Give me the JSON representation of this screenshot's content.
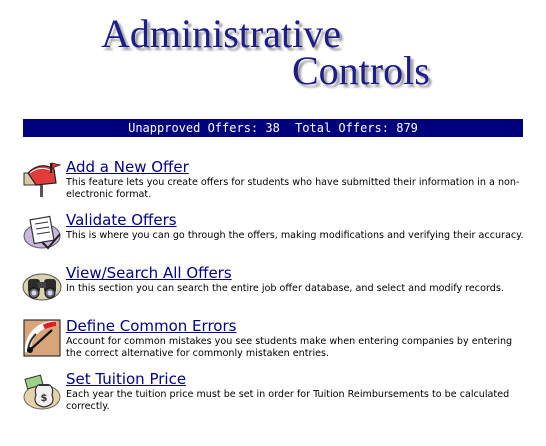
{
  "header": {
    "title_line1": "Administrative",
    "title_line2": "Controls"
  },
  "stats": {
    "unapproved_label": "Unapproved Offers:",
    "unapproved_value": "38",
    "total_label": "Total Offers:",
    "total_value": "879"
  },
  "menu": {
    "items": [
      {
        "label": "Add a New Offer",
        "description": "This feature lets you create offers for students who have submitted their information in a non-electronic format.",
        "icon": "mailbox-icon"
      },
      {
        "label": "Validate Offers",
        "description": "This is where you can go through the offers, making modifications and verifying their accuracy.",
        "icon": "checklist-icon"
      },
      {
        "label": "View/Search All Offers",
        "description": "In this section you can search the entire job offer database, and select and modify records.",
        "icon": "binoculars-icon"
      },
      {
        "label": "Define Common Errors",
        "description": "Account for common mistakes you see students make when entering companies by entering the correct alternative for commonly mistaken entries.",
        "icon": "gauge-icon"
      },
      {
        "label": "Set Tuition Price",
        "description": "Each year the tuition price must be set in order for Tuition Reimbursements to be calculated correctly.",
        "icon": "money-bag-icon"
      }
    ]
  },
  "colors": {
    "title": "#1c1c8c",
    "stats_bar": "#00007d",
    "link": "#00008b"
  }
}
